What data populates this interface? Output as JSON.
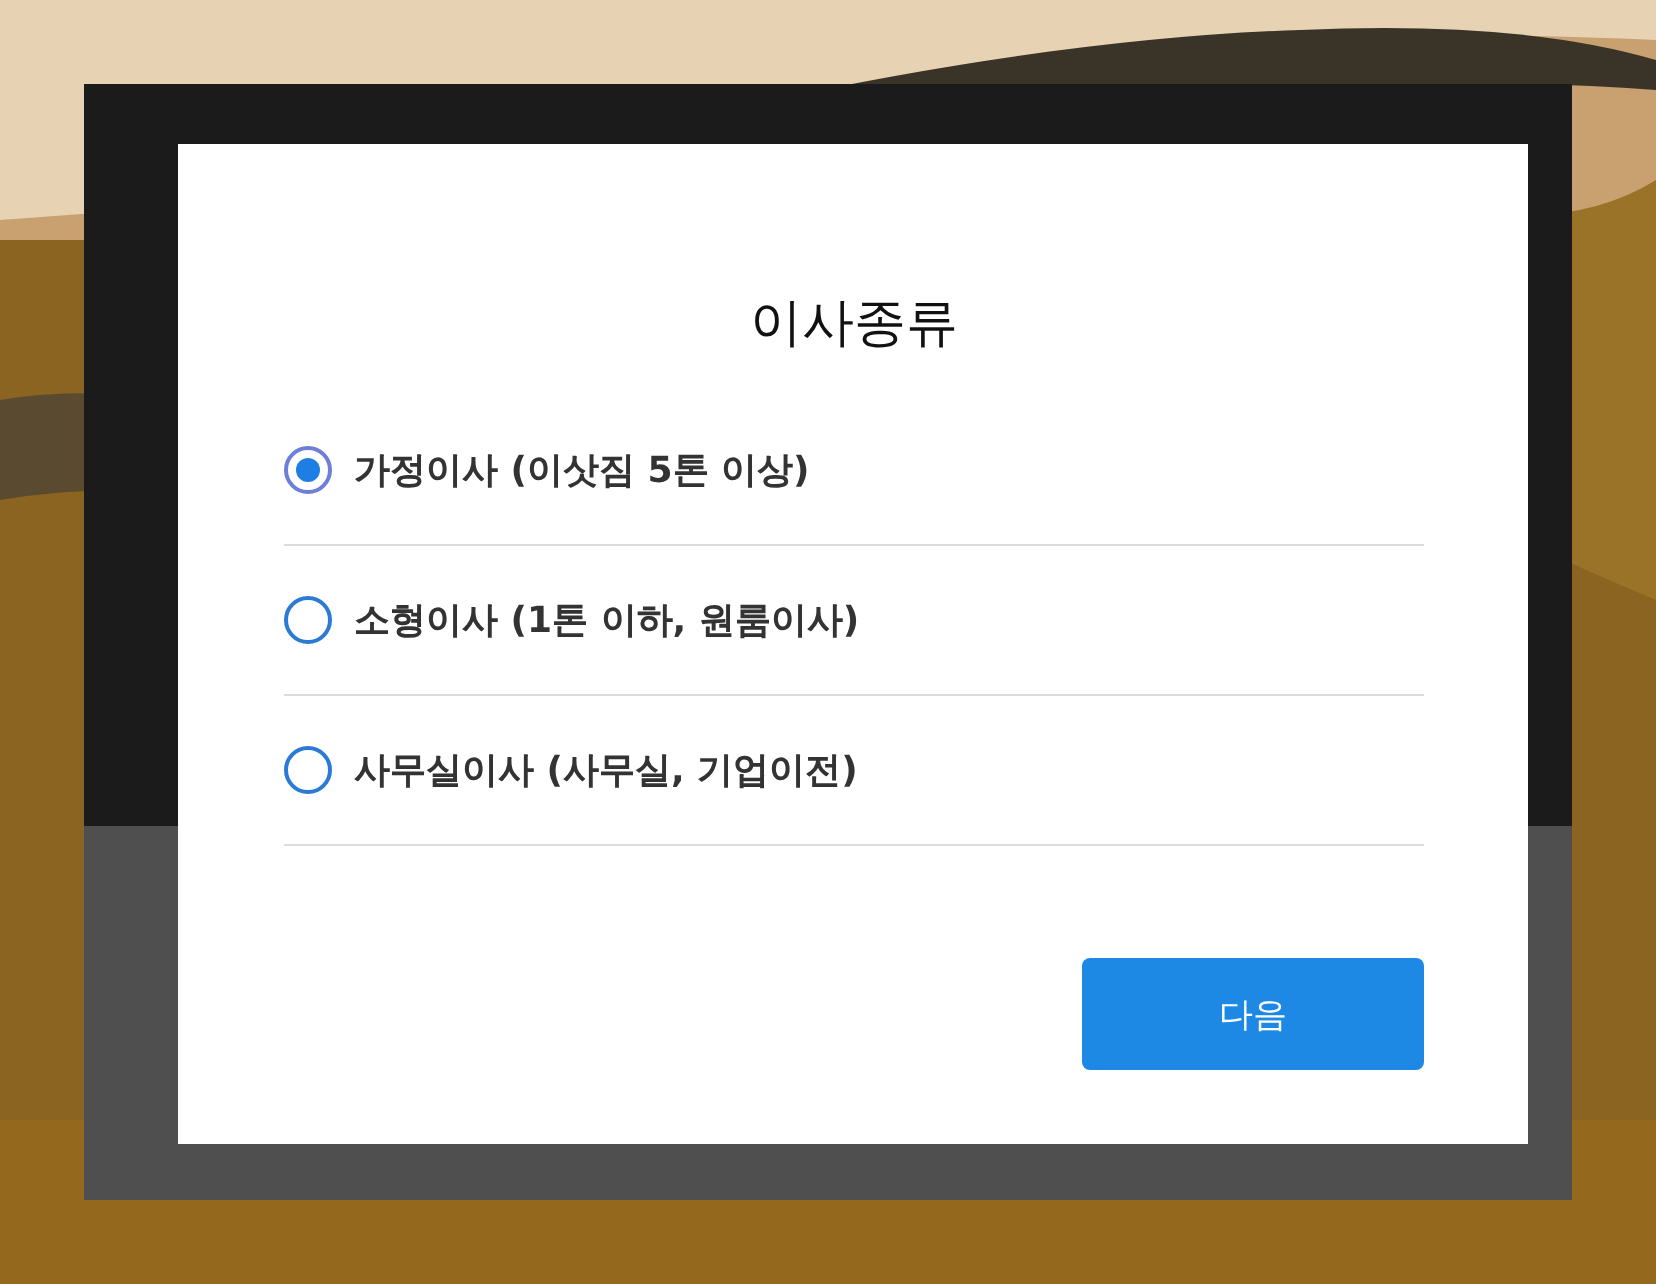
{
  "modal": {
    "title": "이사종류",
    "options": [
      {
        "label": "가정이사 (이삿짐 5톤 이상)",
        "selected": true
      },
      {
        "label": "소형이사 (1톤 이하, 원룸이사)",
        "selected": false
      },
      {
        "label": "사무실이사 (사무실, 기업이전)",
        "selected": false
      }
    ],
    "next_button": "다음"
  }
}
